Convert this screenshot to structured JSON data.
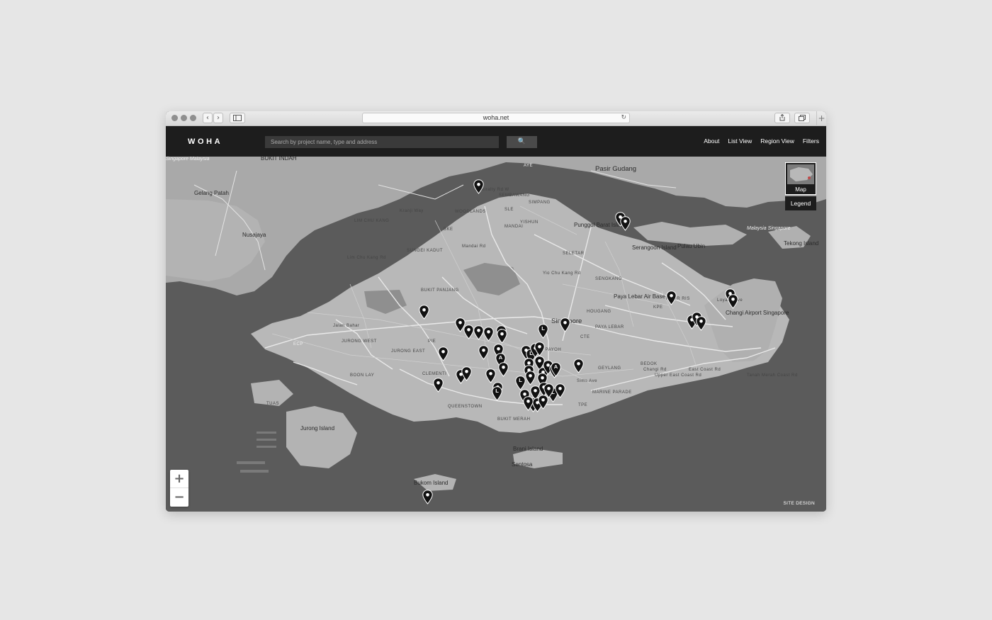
{
  "browser": {
    "url": "woha.net",
    "back_icon": "‹",
    "forward_icon": "›",
    "reload_icon": "↻",
    "new_tab_icon": "+"
  },
  "header": {
    "logo": "WOHA",
    "search": {
      "placeholder": "Search by project name, type and address",
      "button_icon": "🔍"
    },
    "nav": [
      "About",
      "List View",
      "Region View",
      "Filters"
    ]
  },
  "map": {
    "place_labels": [
      {
        "text": "BUKIT INDAH",
        "kind": "mid"
      },
      {
        "text": "Pasir Gudang",
        "kind": "big"
      },
      {
        "text": "Gelang Patah",
        "kind": "mid"
      },
      {
        "text": "Nusajaya",
        "kind": "mid"
      },
      {
        "text": "Punggol Barat Island",
        "kind": "mid"
      },
      {
        "text": "Serangoon Island",
        "kind": "mid"
      },
      {
        "text": "Pulau Ubin",
        "kind": "mid"
      },
      {
        "text": "Tekong Island",
        "kind": "mid"
      },
      {
        "text": "Singapore",
        "kind": "big"
      },
      {
        "text": "Paya Lebar Air Base",
        "kind": "mid"
      },
      {
        "text": "Changi Airport Singapore",
        "kind": "mid"
      },
      {
        "text": "Jurong Island",
        "kind": "mid"
      },
      {
        "text": "Brani Island",
        "kind": "mid"
      },
      {
        "text": "Sentosa",
        "kind": "mid"
      },
      {
        "text": "Bukom Island",
        "kind": "mid"
      },
      {
        "text": "WOODLANDS",
        "kind": "small"
      },
      {
        "text": "SEMBAWANG",
        "kind": "small"
      },
      {
        "text": "SIMPANG",
        "kind": "small"
      },
      {
        "text": "YISHUN",
        "kind": "small"
      },
      {
        "text": "MANDAI",
        "kind": "small"
      },
      {
        "text": "LIM CHU KANG",
        "kind": "small"
      },
      {
        "text": "SUNGEI KADUT",
        "kind": "small"
      },
      {
        "text": "BUKIT PANJANG",
        "kind": "small"
      },
      {
        "text": "SELETAR",
        "kind": "small"
      },
      {
        "text": "SENGKANG",
        "kind": "small"
      },
      {
        "text": "HOUGANG",
        "kind": "small"
      },
      {
        "text": "PAYA LEBAR",
        "kind": "small"
      },
      {
        "text": "PASIR RIS",
        "kind": "small"
      },
      {
        "text": "JURONG WEST",
        "kind": "small"
      },
      {
        "text": "JURONG EAST",
        "kind": "small"
      },
      {
        "text": "BOON LAY",
        "kind": "small"
      },
      {
        "text": "CLEMENTI",
        "kind": "small"
      },
      {
        "text": "QUEENSTOWN",
        "kind": "small"
      },
      {
        "text": "BUKIT MERAH",
        "kind": "small"
      },
      {
        "text": "TOA PAYOH",
        "kind": "small"
      },
      {
        "text": "GEYLANG",
        "kind": "small"
      },
      {
        "text": "BEDOK",
        "kind": "small"
      },
      {
        "text": "MARINE PARADE",
        "kind": "small"
      },
      {
        "text": "TUAS",
        "kind": "small"
      },
      {
        "text": "Upper East Coast Rd",
        "kind": "small"
      },
      {
        "text": "East Coast Rd",
        "kind": "small"
      },
      {
        "text": "Tanah Merah Coast Rd",
        "kind": "small"
      },
      {
        "text": "Admiralty Rd W",
        "kind": "small"
      },
      {
        "text": "Kranji Way",
        "kind": "small"
      },
      {
        "text": "Lim Chu Kang Rd",
        "kind": "small"
      },
      {
        "text": "Jalan Bahar",
        "kind": "small"
      },
      {
        "text": "Mandai Rd",
        "kind": "small"
      },
      {
        "text": "Yio Chu Kang Rd",
        "kind": "small"
      },
      {
        "text": "Loyang Ave",
        "kind": "small"
      },
      {
        "text": "Changi Rd",
        "kind": "small"
      },
      {
        "text": "Sims Ave",
        "kind": "small"
      },
      {
        "text": "PIE",
        "kind": "small"
      },
      {
        "text": "BKE",
        "kind": "small"
      },
      {
        "text": "SLE",
        "kind": "small"
      },
      {
        "text": "CTE",
        "kind": "small"
      },
      {
        "text": "KPE",
        "kind": "small"
      },
      {
        "text": "TPE",
        "kind": "small"
      },
      {
        "text": "ECP",
        "kind": "small"
      },
      {
        "text": "AYE",
        "kind": "small"
      },
      {
        "text": "Malaysia Singapore",
        "kind": "sea"
      },
      {
        "text": "Singapore Malaysia",
        "kind": "sea"
      }
    ],
    "markers": [
      {
        "letter": ""
      },
      {
        "letter": ""
      },
      {
        "letter": ""
      },
      {
        "letter": ""
      },
      {
        "letter": ""
      },
      {
        "letter": ""
      },
      {
        "letter": ""
      },
      {
        "letter": ""
      },
      {
        "letter": ""
      },
      {
        "letter": ""
      },
      {
        "letter": ""
      },
      {
        "letter": ""
      },
      {
        "letter": "L"
      },
      {
        "letter": ""
      },
      {
        "letter": ""
      },
      {
        "letter": ""
      },
      {
        "letter": ""
      },
      {
        "letter": ""
      },
      {
        "letter": ""
      },
      {
        "letter": ""
      },
      {
        "letter": "A"
      },
      {
        "letter": ""
      },
      {
        "letter": ""
      },
      {
        "letter": "L"
      },
      {
        "letter": ""
      },
      {
        "letter": ""
      },
      {
        "letter": ""
      },
      {
        "letter": ""
      },
      {
        "letter": ""
      },
      {
        "letter": ""
      },
      {
        "letter": "L"
      },
      {
        "letter": ""
      },
      {
        "letter": ""
      },
      {
        "letter": ""
      },
      {
        "letter": ""
      },
      {
        "letter": ""
      },
      {
        "letter": ""
      },
      {
        "letter": ""
      },
      {
        "letter": ""
      },
      {
        "letter": "A"
      },
      {
        "letter": ""
      },
      {
        "letter": ""
      },
      {
        "letter": "L"
      },
      {
        "letter": ""
      },
      {
        "letter": ""
      },
      {
        "letter": ""
      },
      {
        "letter": ""
      },
      {
        "letter": ""
      },
      {
        "letter": ""
      },
      {
        "letter": ""
      },
      {
        "letter": ""
      },
      {
        "letter": ""
      },
      {
        "letter": ""
      },
      {
        "letter": "L"
      },
      {
        "letter": ""
      }
    ],
    "controls": {
      "map_type_label": "Map",
      "legend_label": "Legend",
      "zoom_in": "+",
      "zoom_out": "−",
      "credit": "SITE DESIGN"
    }
  },
  "colors": {
    "page_background": "#e6e6e6",
    "navbar": "#1d1d1d",
    "water": "#5a5a5a",
    "land": "#a9a9a9",
    "marker": "#111111"
  }
}
